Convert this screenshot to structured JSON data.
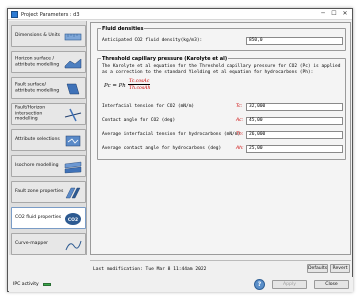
{
  "window": {
    "title": "Project Parameters : d3",
    "minimize": "─",
    "maximize": "☐",
    "close": "✕"
  },
  "sidebar": {
    "items": [
      {
        "label": "Dimensions & Units",
        "icon": "ruler-icon"
      },
      {
        "label": "Horizon surface / attribute modelling",
        "icon": "horizon-surface-icon"
      },
      {
        "label": "Fault surface/ attribute modelling",
        "icon": "fault-surface-icon"
      },
      {
        "label": "Fault/Horizon intersection modelling",
        "icon": "intersection-icon"
      },
      {
        "label": "Attribute selections",
        "icon": "attribute-selection-icon"
      },
      {
        "label": "Isochore modelling",
        "icon": "isochore-icon"
      },
      {
        "label": "Fault zone properties",
        "icon": "fault-zone-icon"
      },
      {
        "label": "CO2 fluid properties",
        "icon": "co2-icon",
        "badge": "CO2",
        "active": true
      },
      {
        "label": "Curve-mapper",
        "icon": "curve-mapper-icon"
      }
    ]
  },
  "fluid_densities": {
    "title": "Fluid densities",
    "co2_label": "Anticipated CO2 fluid density(kg/m3):",
    "co2_value": "850,0"
  },
  "threshold": {
    "title": "Threshold capillary pressure (Karolyte et al)",
    "description": "The Karolyte et al equation for the Threshold capillary pressure for CO2 (Pc) is applied as a correction to the standard Yielding et al equation for hydrocarbons (Ph):",
    "equation": {
      "lhs": "Pc = Ph",
      "num": "Tc.cosAc",
      "den": "Th.cosAh"
    },
    "fields": [
      {
        "label": "Interfacial tension for CO2 (mN/m)",
        "symbol": "Tc:",
        "value": "32,000"
      },
      {
        "label": "Contact angle for CO2 (deg)",
        "symbol": "Ac:",
        "value": "45,00"
      },
      {
        "label": "Average interfacial tension for hydrocarbons (mN/m)",
        "symbol": "Th:",
        "value": "26,000"
      },
      {
        "label": "Average contact angle for hydrocarbons (deg)",
        "symbol": "Ah:",
        "value": "25,00"
      }
    ]
  },
  "footer": {
    "last_modified": "Last modification:  Tue Mar 8 11:44am 2022",
    "defaults": "Defaults",
    "revert": "Revert",
    "apply": "Apply",
    "close": "Close",
    "help": "?"
  },
  "status": {
    "ipc_label": "IPC activity",
    "ipc_color": "#3aa84a"
  }
}
